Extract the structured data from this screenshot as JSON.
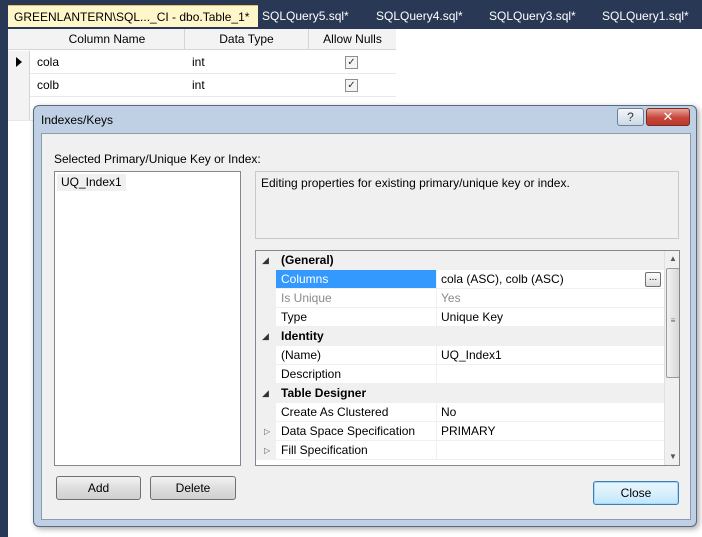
{
  "tabs": [
    {
      "label": "GREENLANTERN\\SQL..._CI - dbo.Table_1*",
      "active": true
    },
    {
      "label": "SQLQuery5.sql*",
      "active": false
    },
    {
      "label": "SQLQuery4.sql*",
      "active": false
    },
    {
      "label": "SQLQuery3.sql*",
      "active": false
    },
    {
      "label": "SQLQuery1.sql*",
      "active": false
    }
  ],
  "designer": {
    "headers": {
      "column_name": "Column Name",
      "data_type": "Data Type",
      "allow_nulls": "Allow Nulls"
    },
    "rows": [
      {
        "name": "cola",
        "type": "int",
        "allow_nulls": true,
        "current": true
      },
      {
        "name": "colb",
        "type": "int",
        "allow_nulls": true,
        "current": false
      }
    ]
  },
  "dialog": {
    "title": "Indexes/Keys",
    "help_label": "?",
    "close_glyph": "✕",
    "list_label": "Selected Primary/Unique Key or Index:",
    "keys": [
      "UQ_Index1"
    ],
    "description": "Editing properties for existing primary/unique key or index.",
    "properties": {
      "general": {
        "label": "(General)",
        "columns": {
          "name": "Columns",
          "value": "cola (ASC), colb (ASC)"
        },
        "is_unique": {
          "name": "Is Unique",
          "value": "Yes"
        },
        "type": {
          "name": "Type",
          "value": "Unique Key"
        }
      },
      "identity": {
        "label": "Identity",
        "name": {
          "name": "(Name)",
          "value": "UQ_Index1"
        },
        "description": {
          "name": "Description",
          "value": ""
        }
      },
      "table_designer": {
        "label": "Table Designer",
        "create_as_clustered": {
          "name": "Create As Clustered",
          "value": "No"
        },
        "data_space": {
          "name": "Data Space Specification",
          "value": "PRIMARY"
        },
        "fill_spec": {
          "name": "Fill Specification",
          "value": ""
        }
      }
    },
    "ellipsis_label": "...",
    "buttons": {
      "add": "Add",
      "delete": "Delete",
      "close": "Close"
    }
  },
  "colors": {
    "tab_strip": "#293955",
    "active_tab": "#fff6c9",
    "dialog_frame": "#bfd0e4",
    "selection": "#3399ff"
  }
}
